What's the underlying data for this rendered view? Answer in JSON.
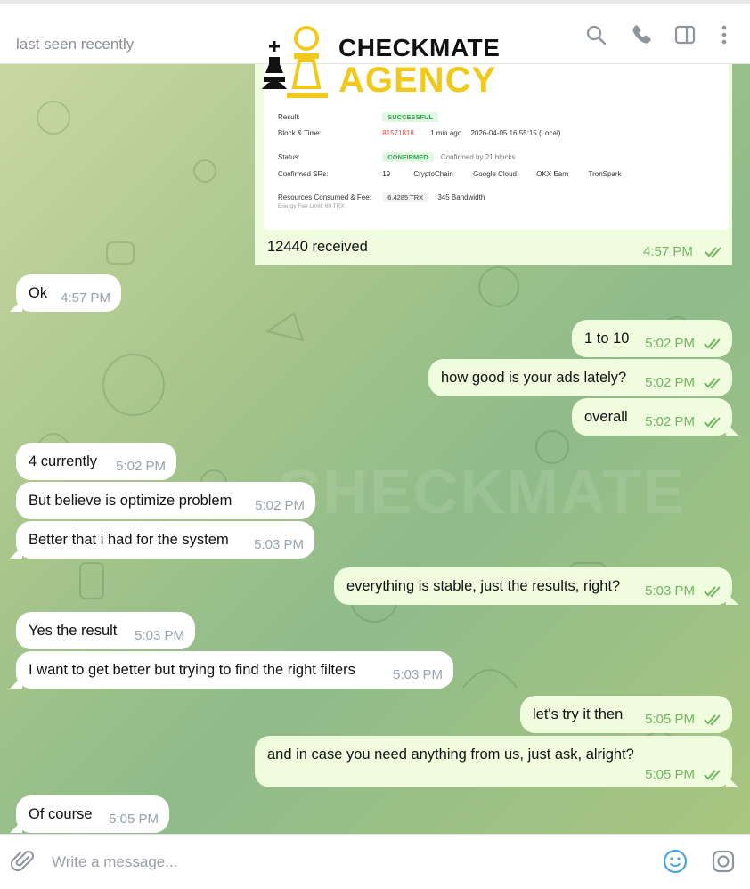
{
  "header": {
    "status": "last seen recently",
    "icons": [
      "search-icon",
      "phone-icon",
      "sidebar-toggle-icon",
      "more-vertical-icon"
    ]
  },
  "logo": {
    "line1": "CHECKMATE",
    "line2": "AGENCY",
    "brand_color": "#f1c91b"
  },
  "watermark": "CHECKMATE",
  "media_message": {
    "screenshot": {
      "rows": [
        {
          "label": "Result:",
          "value": "SUCCESSFUL"
        },
        {
          "label": "Block & Time:",
          "block": "81571818",
          "ago": "1 min ago",
          "time": "2026-04-05 16:55:15 (Local)"
        },
        {
          "label": "Status:",
          "value": "CONFIRMED",
          "extra": "Confirmed by 21 blocks"
        },
        {
          "label": "Confirmed SRs:",
          "count": "19",
          "srs": [
            "CryptoChain",
            "Google Cloud",
            "OKX Earn",
            "TronSpark"
          ]
        },
        {
          "label": "Resources Consumed & Fee:",
          "sublabel": "Energy Fee Limit: 60 TRX",
          "fee": "6.4285 TRX",
          "bandwidth": "345 Bandwidth"
        }
      ]
    },
    "caption": "12440 received",
    "time": "4:57 PM"
  },
  "messages": [
    {
      "dir": "in",
      "text": "Ok",
      "time": "4:57 PM"
    },
    {
      "dir": "out",
      "text": "1 to 10",
      "time": "5:02 PM"
    },
    {
      "dir": "out",
      "text": "how good is your ads lately?",
      "time": "5:02 PM"
    },
    {
      "dir": "out",
      "text": "overall",
      "time": "5:02 PM"
    },
    {
      "dir": "in",
      "text": "4 currently",
      "time": "5:02 PM"
    },
    {
      "dir": "in",
      "text": "But believe is optimize problem",
      "time": "5:02 PM"
    },
    {
      "dir": "in",
      "text": "Better that i had for the system",
      "time": "5:03 PM"
    },
    {
      "dir": "out",
      "text": "everything is stable, just the results, right?",
      "time": "5:03 PM"
    },
    {
      "dir": "in",
      "text": "Yes the result",
      "time": "5:03 PM"
    },
    {
      "dir": "in",
      "text": "I want to get better but trying to find the right filters",
      "time": "5:03 PM"
    },
    {
      "dir": "out",
      "text": "let's try it then",
      "time": "5:05 PM"
    },
    {
      "dir": "out",
      "text": "and in case you need anything from us, just ask, alright?",
      "time": "5:05 PM"
    },
    {
      "dir": "in",
      "text": "Of course",
      "time": "5:05 PM"
    }
  ],
  "composer": {
    "placeholder": "Write a message..."
  },
  "colors": {
    "incoming": "#ffffff",
    "outgoing": "#effdde",
    "out_time": "#6fb65f",
    "in_time": "#98a3ac"
  }
}
